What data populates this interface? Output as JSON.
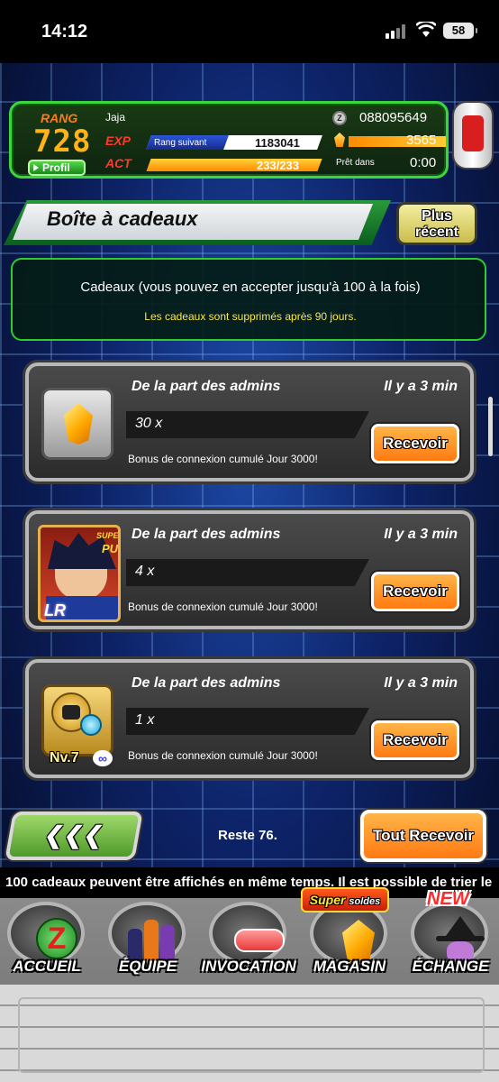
{
  "status_bar": {
    "time": "14:12",
    "battery": "58"
  },
  "header": {
    "rank_label": "RANG",
    "rank_value": "728",
    "profile_button": "Profil",
    "player_name": "Jaja",
    "exp_label": "EXP",
    "next_rank_label": "Rang suivant",
    "exp_value": "1183041",
    "exp_progress": 0.45,
    "act_label": "ACT",
    "act_value": "233/233",
    "act_progress": 1.0,
    "zeni_value": "088095649",
    "dragon_stones": "3565",
    "ready_label": "Prêt dans",
    "ready_value": "0:00"
  },
  "title": {
    "text": "Boîte à cadeaux",
    "sort_button": "Plus récent"
  },
  "info": {
    "main": "Cadeaux (vous pouvez en accepter jusqu'à 100 à la fois)",
    "sub": "Les cadeaux sont supprimés après 90 jours."
  },
  "gifts": [
    {
      "from": "De la part des admins",
      "when": "Il y a 3 min",
      "quantity": "30 x",
      "description": "Bonus de connexion cumulé Jour 3000!",
      "button": "Recevoir",
      "icon": "dragon-stone-icon"
    },
    {
      "from": "De la part des admins",
      "when": "Il y a 3 min",
      "quantity": "4 x",
      "description": "Bonus de connexion cumulé Jour 3000!",
      "button": "Recevoir",
      "icon": "character-card-icon",
      "super_tag": "SUPER",
      "pui_tag": "PUI",
      "rarity": "LR"
    },
    {
      "from": "De la part des admins",
      "when": "Il y a 3 min",
      "quantity": "1 x",
      "description": "Bonus de connexion cumulé Jour 3000!",
      "button": "Recevoir",
      "icon": "support-memory-icon",
      "level": "Nv.7",
      "infinity": "∞"
    }
  ],
  "footer": {
    "back_button": "❮❮❮",
    "remaining": "Reste 76.",
    "receive_all": "Tout Recevoir",
    "ticker": "100 cadeaux peuvent être affichés en même temps. Il est possible de trier le"
  },
  "nav": {
    "items": [
      {
        "label": "ACCUEIL",
        "icon": "z-emblem-icon"
      },
      {
        "label": "ÉQUIPE",
        "icon": "team-icon"
      },
      {
        "label": "INVOCATION",
        "icon": "summon-capsule-icon"
      },
      {
        "label": "MAGASIN",
        "icon": "dragon-stone-icon"
      },
      {
        "label": "ÉCHANGE",
        "icon": "exchange-merchant-icon"
      }
    ],
    "super_badge": "Super",
    "super_badge_sub": "soldes",
    "new_badge": "NEW"
  },
  "colors": {
    "accent_green": "#3cd63c",
    "button_orange": "#ff7a12",
    "info_yellow": "#ffe73a"
  }
}
